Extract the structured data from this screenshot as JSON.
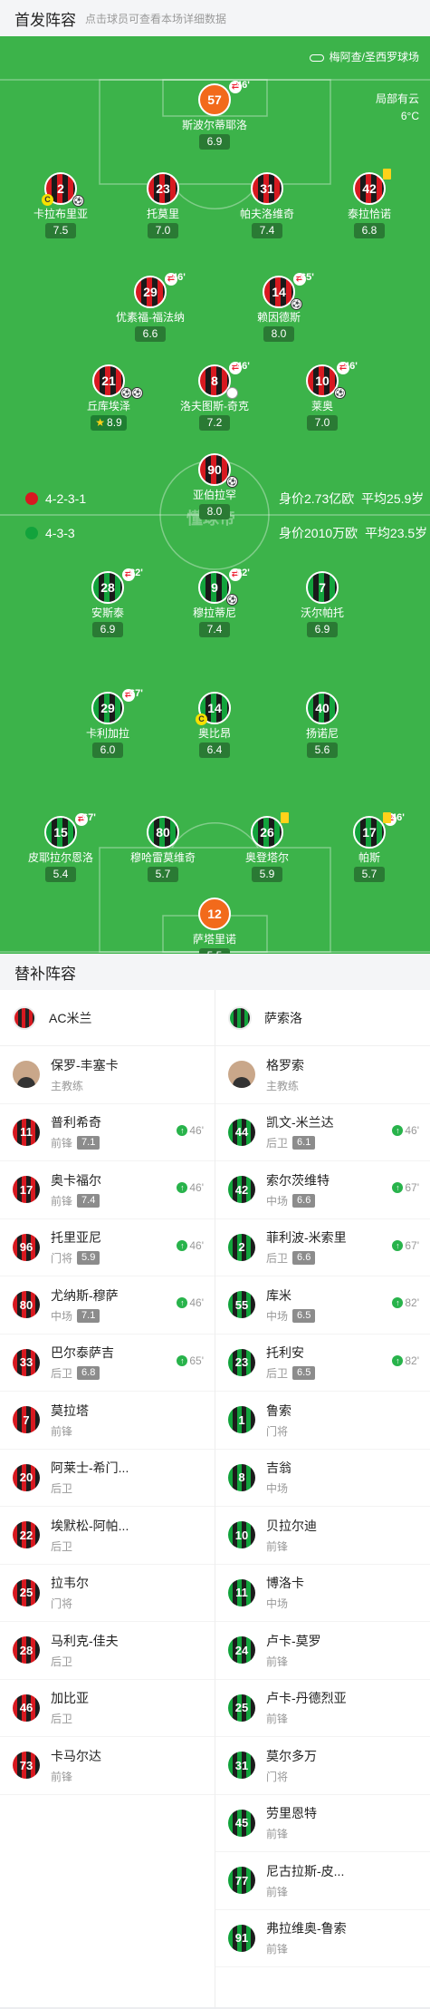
{
  "header": {
    "title": "首发阵容",
    "subtitle": "点击球员可查看本场详细数据"
  },
  "venue": "梅阿查/圣西罗球场",
  "weather": {
    "desc": "局部有云",
    "temp": "6°C"
  },
  "watermark": "懂球帝",
  "home": {
    "formation": "4-2-3-1",
    "value": "身价2.73亿欧",
    "age": "平均25.9岁"
  },
  "away": {
    "formation": "4-3-3",
    "value": "身价2010万欧",
    "age": "平均23.5岁"
  },
  "home_players": [
    {
      "num": "57",
      "name": "斯波尔蒂耶洛",
      "rating": "6.9",
      "sub": "46'",
      "gk": true
    },
    {
      "num": "2",
      "name": "卡拉布里亚",
      "rating": "7.5",
      "capt": true,
      "ball": 1
    },
    {
      "num": "23",
      "name": "托莫里",
      "rating": "7.0"
    },
    {
      "num": "31",
      "name": "帕夫洛维奇",
      "rating": "7.4"
    },
    {
      "num": "42",
      "name": "泰拉恰诺",
      "rating": "6.8",
      "ycard": true
    },
    {
      "num": "29",
      "name": "优素福-福法纳",
      "rating": "6.6",
      "sub": "46'"
    },
    {
      "num": "14",
      "name": "赖因德斯",
      "rating": "8.0",
      "sub": "65'",
      "ball": 1
    },
    {
      "num": "21",
      "name": "丘库埃泽",
      "rating": "8.9",
      "ball": 2,
      "best": true
    },
    {
      "num": "8",
      "name": "洛夫图斯-奇克",
      "rating": "7.2",
      "sub": "46'",
      "card": true
    },
    {
      "num": "10",
      "name": "莱奥",
      "rating": "7.0",
      "sub": "46'",
      "ball": 1
    },
    {
      "num": "90",
      "name": "亚伯拉罕",
      "rating": "8.0",
      "ball": 1,
      "card": true
    }
  ],
  "away_players": [
    {
      "num": "28",
      "name": "安斯泰",
      "rating": "6.9",
      "sub": "82'"
    },
    {
      "num": "9",
      "name": "穆拉蒂尼",
      "rating": "7.4",
      "sub": "82'",
      "ball": 1
    },
    {
      "num": "7",
      "name": "沃尔帕托",
      "rating": "6.9"
    },
    {
      "num": "29",
      "name": "卡利加拉",
      "rating": "6.0",
      "sub": "67'"
    },
    {
      "num": "14",
      "name": "奥比昂",
      "rating": "6.4",
      "capt": true
    },
    {
      "num": "40",
      "name": "扬诺尼",
      "rating": "5.6"
    },
    {
      "num": "15",
      "name": "皮耶拉尔恩洛",
      "rating": "5.4",
      "sub": "67'"
    },
    {
      "num": "80",
      "name": "穆哈雷莫维奇",
      "rating": "5.7"
    },
    {
      "num": "26",
      "name": "奥登塔尔",
      "rating": "5.9",
      "ycard": true
    },
    {
      "num": "17",
      "name": "帕斯",
      "rating": "5.7",
      "sub": "46'",
      "ycard": true
    },
    {
      "num": "12",
      "name": "萨塔里诺",
      "rating": "5.5",
      "gk": true
    }
  ],
  "subs_title": "替补阵容",
  "subs": {
    "left": {
      "team": "AC米兰",
      "coach": {
        "name": "保罗-丰塞卡",
        "role": "主教练"
      },
      "players": [
        {
          "num": "11",
          "name": "普利希奇",
          "pos": "前锋",
          "rating": "7.1",
          "in": "46'"
        },
        {
          "num": "17",
          "name": "奥卡福尔",
          "pos": "前锋",
          "rating": "7.4",
          "in": "46'"
        },
        {
          "num": "96",
          "name": "托里亚尼",
          "pos": "门将",
          "rating": "5.9",
          "in": "46'"
        },
        {
          "num": "80",
          "name": "尤纳斯-穆萨",
          "pos": "中场",
          "rating": "7.1",
          "in": "46'"
        },
        {
          "num": "33",
          "name": "巴尔泰萨吉",
          "pos": "后卫",
          "rating": "6.8",
          "in": "65'"
        },
        {
          "num": "7",
          "name": "莫拉塔",
          "pos": "前锋"
        },
        {
          "num": "20",
          "name": "阿莱士-希门...",
          "pos": "后卫"
        },
        {
          "num": "22",
          "name": "埃默松-阿帕...",
          "pos": "后卫"
        },
        {
          "num": "25",
          "name": "拉韦尔",
          "pos": "门将"
        },
        {
          "num": "28",
          "name": "马利克-佳夫",
          "pos": "后卫"
        },
        {
          "num": "46",
          "name": "加比亚",
          "pos": "后卫"
        },
        {
          "num": "73",
          "name": "卡马尔达",
          "pos": "前锋"
        }
      ]
    },
    "right": {
      "team": "萨索洛",
      "coach": {
        "name": "格罗索",
        "role": "主教练"
      },
      "players": [
        {
          "num": "44",
          "name": "凯文-米兰达",
          "pos": "后卫",
          "rating": "6.1",
          "in": "46'"
        },
        {
          "num": "42",
          "name": "索尔茨维特",
          "pos": "中场",
          "rating": "6.6",
          "in": "67'"
        },
        {
          "num": "2",
          "name": "菲利波-米索里",
          "pos": "后卫",
          "rating": "6.6",
          "in": "67'"
        },
        {
          "num": "55",
          "name": "库米",
          "pos": "中场",
          "rating": "6.5",
          "in": "82'"
        },
        {
          "num": "23",
          "name": "托利安",
          "pos": "后卫",
          "rating": "6.5",
          "in": "82'"
        },
        {
          "num": "1",
          "name": "鲁索",
          "pos": "门将"
        },
        {
          "num": "8",
          "name": "吉翁",
          "pos": "中场"
        },
        {
          "num": "10",
          "name": "贝拉尔迪",
          "pos": "前锋"
        },
        {
          "num": "11",
          "name": "博洛卡",
          "pos": "中场"
        },
        {
          "num": "24",
          "name": "卢卡-莫罗",
          "pos": "前锋"
        },
        {
          "num": "25",
          "name": "卢卡-丹德烈亚",
          "pos": "前锋"
        },
        {
          "num": "31",
          "name": "莫尔多万",
          "pos": "门将"
        },
        {
          "num": "45",
          "name": "劳里恩特",
          "pos": "前锋"
        },
        {
          "num": "77",
          "name": "尼古拉斯-皮...",
          "pos": "前锋"
        },
        {
          "num": "91",
          "name": "弗拉维奥-鲁索",
          "pos": "前锋"
        }
      ]
    }
  }
}
